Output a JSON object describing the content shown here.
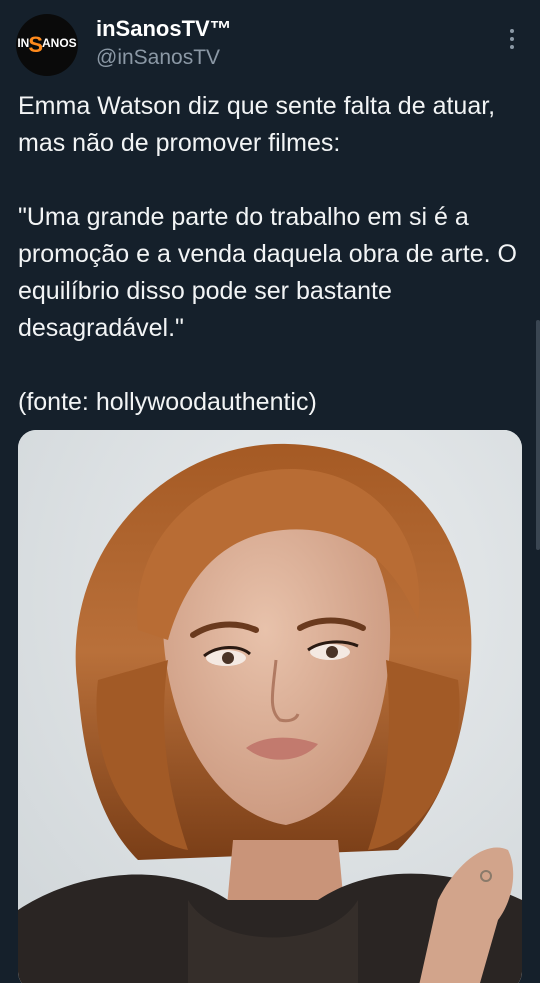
{
  "header": {
    "display_name": "inSanosTV™",
    "handle": "@inSanosTV",
    "avatar_text": {
      "left": "IN",
      "middle": "S",
      "right": "ANOS"
    }
  },
  "tweet": {
    "paragraphs": [
      "Emma Watson diz que sente falta de atuar, mas não de promover filmes:",
      "\"Uma grande parte do trabalho em si é a promoção e a venda daquela obra de arte. O equilíbrio disso pode ser bastante desagradável.\"",
      "(fonte: hollywoodauthentic)"
    ]
  },
  "media": {
    "alt": "Portrait photo of Emma Watson"
  },
  "icons": {
    "more": "more-vertical-icon"
  },
  "colors": {
    "background": "#15202b",
    "text": "#ffffff",
    "secondary_text": "#8b98a5",
    "avatar_accent": "#ff8a1c"
  }
}
